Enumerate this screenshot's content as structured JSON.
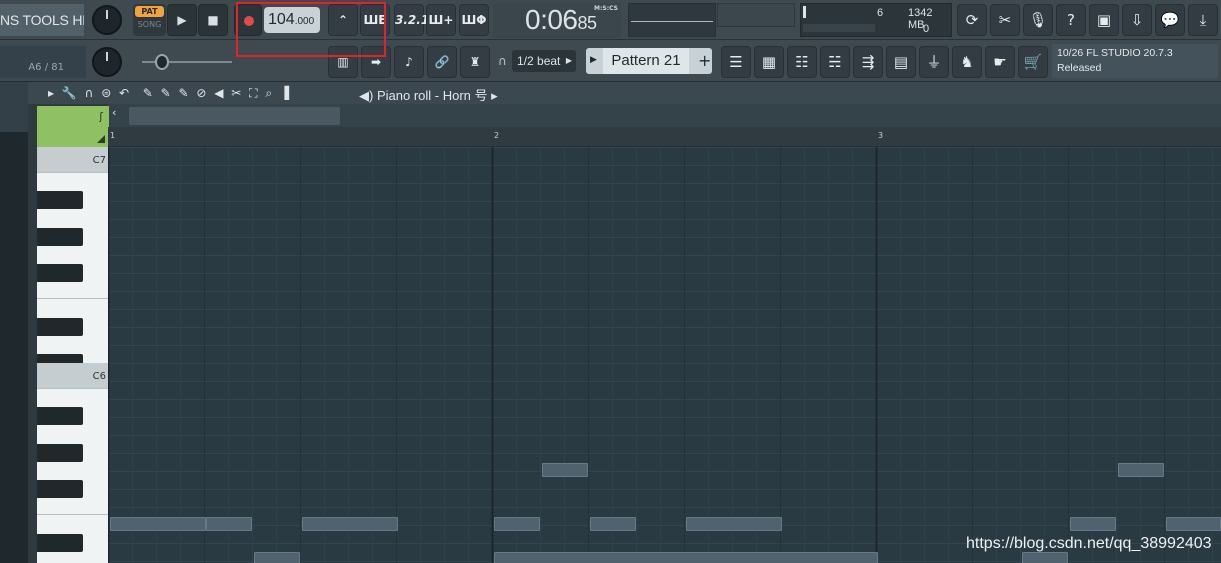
{
  "menu": {
    "text": "NS TOOLS HELP"
  },
  "hint_left": "A6 / 81",
  "transport": {
    "pat": "PAT",
    "song": "SONG",
    "play_icon": "play-icon",
    "stop_icon": "stop-icon",
    "record_icon": "record-icon"
  },
  "tempo": {
    "int": "104",
    "dec": ".000"
  },
  "toolbar_icons": [
    "metronome-icon",
    "wait-record-icon",
    "countdown-icon",
    "step-edit-icon",
    "loop-record-icon"
  ],
  "toolbar_labels": {
    "countdown": "3.2.1",
    "step": "Ш+",
    "loop": "ШΦ",
    "typing": "ШЕ"
  },
  "clock": {
    "main": "0:06",
    "sub": "85",
    "unit": "M:S:CS"
  },
  "cpu": {
    "voices": "6",
    "memory": "1342 MB",
    "poly": "0"
  },
  "right_icons": [
    "reset-icon",
    "cut-icon",
    "mic-icon",
    "help-icon",
    "save-icon",
    "render-icon",
    "chat-icon",
    "download-icon"
  ],
  "row2_icons": [
    "typing-keyboard-icon",
    "arrow-right-icon",
    "quantize-icon",
    "link-icon",
    "metronome2-icon"
  ],
  "snap": {
    "value": "1/2 beat"
  },
  "pattern": {
    "name": "Pattern 21",
    "plus": "+"
  },
  "window_icons": [
    "playlist-icon",
    "piano-roll-icon",
    "channel-rack-icon",
    "mixer-icon",
    "browser-icon",
    "project-icon",
    "plugin-icon",
    "picker-icon",
    "pointer-icon",
    "shop-icon"
  ],
  "hint_box": {
    "line1": "10/26  FL STUDIO 20.7.3",
    "line2": "Released"
  },
  "piano_roll": {
    "title": "Piano roll - Horn 号",
    "arrow": "▸"
  },
  "ruler": {
    "marks": [
      "1",
      "2",
      "3"
    ]
  },
  "keys": {
    "c7": "C7",
    "c6": "C6"
  },
  "watermark": "https://blog.csdn.net/qq_38992403",
  "colors": {
    "accent": "#f0a33e",
    "record": "#e24a4a",
    "highlight": "#e0242a",
    "corner": "#8fc064"
  }
}
